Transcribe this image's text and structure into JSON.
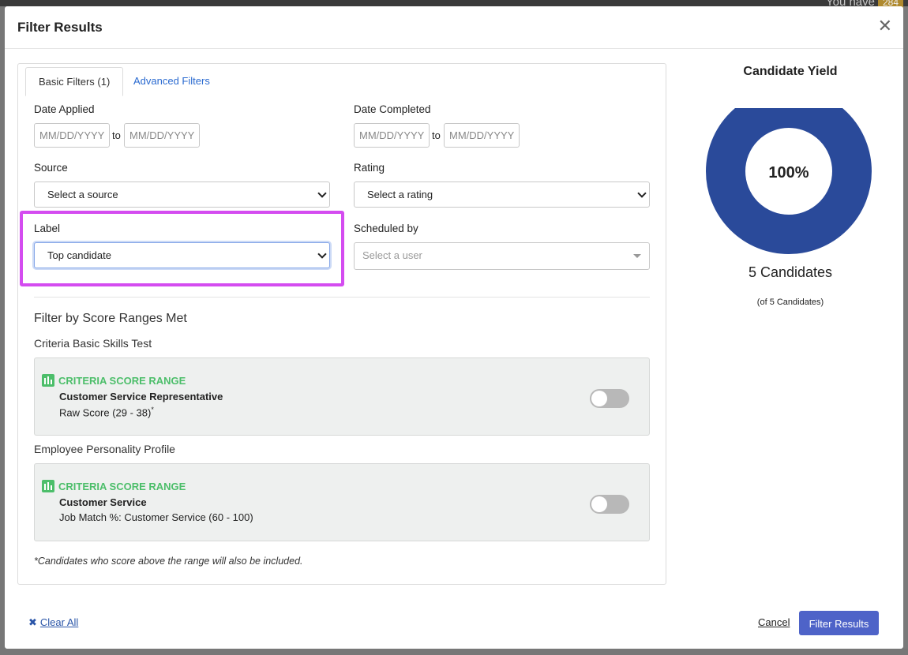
{
  "background": {
    "top_text": "You have",
    "badge": "284"
  },
  "modal": {
    "title": "Filter Results"
  },
  "tabs": [
    {
      "label": "Basic Filters (1)",
      "active": true
    },
    {
      "label": "Advanced Filters",
      "active": false
    }
  ],
  "filters": {
    "date_applied": {
      "label": "Date Applied",
      "from_placeholder": "MM/DD/YYYY",
      "to_placeholder": "MM/DD/YYYY",
      "to_text": "to"
    },
    "date_completed": {
      "label": "Date Completed",
      "from_placeholder": "MM/DD/YYYY",
      "to_placeholder": "MM/DD/YYYY",
      "to_text": "to"
    },
    "source": {
      "label": "Source",
      "value": "Select a source"
    },
    "rating": {
      "label": "Rating",
      "value": "Select a rating"
    },
    "label": {
      "label": "Label",
      "value": "Top candidate"
    },
    "scheduled_by": {
      "label": "Scheduled by",
      "placeholder": "Select a user"
    }
  },
  "score_ranges": {
    "title": "Filter by Score Ranges Met",
    "groups": [
      {
        "test": "Criteria Basic Skills Test",
        "heading": "CRITERIA SCORE RANGE",
        "name": "Customer Service Representative",
        "range": "Raw Score (29 - 38)",
        "superscript": "*",
        "enabled": false
      },
      {
        "test": "Employee Personality Profile",
        "heading": "CRITERIA SCORE RANGE",
        "name": "Customer Service",
        "range": "Job Match %: Customer Service (60 - 100)",
        "superscript": "",
        "enabled": false
      }
    ],
    "footnote": "*Candidates who score above the range will also be included."
  },
  "yield": {
    "title": "Candidate Yield",
    "percent_label": "100%",
    "percent": 100,
    "count": "5 Candidates",
    "total": "(of 5 Candidates)",
    "color": "#2a4a9a"
  },
  "footer": {
    "clear_all": "Clear All",
    "cancel": "Cancel",
    "submit": "Filter Results"
  }
}
